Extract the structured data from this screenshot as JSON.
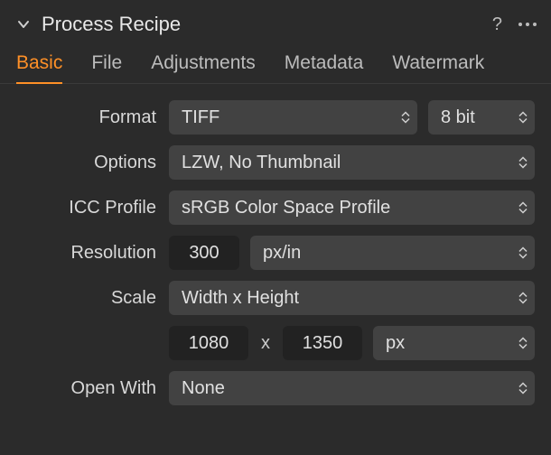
{
  "header": {
    "title": "Process Recipe"
  },
  "tabs": {
    "t0": "Basic",
    "t1": "File",
    "t2": "Adjustments",
    "t3": "Metadata",
    "t4": "Watermark"
  },
  "labels": {
    "format": "Format",
    "options": "Options",
    "icc": "ICC Profile",
    "resolution": "Resolution",
    "scale": "Scale",
    "openwith": "Open With"
  },
  "values": {
    "format_type": "TIFF",
    "format_depth": "8 bit",
    "options": "LZW, No Thumbnail",
    "icc": "sRGB Color Space Profile",
    "resolution_value": "300",
    "resolution_unit": "px/in",
    "scale_mode": "Width x Height",
    "scale_w": "1080",
    "scale_x": "x",
    "scale_h": "1350",
    "scale_unit": "px",
    "openwith": "None"
  }
}
